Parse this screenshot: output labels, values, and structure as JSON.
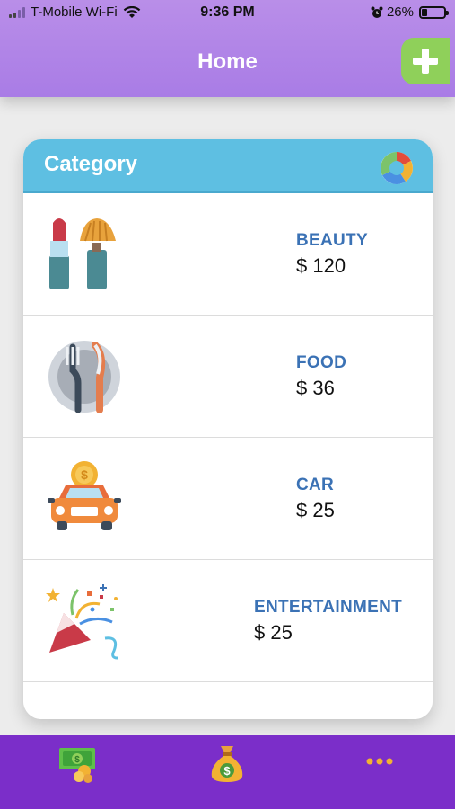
{
  "status": {
    "carrier": "T-Mobile Wi-Fi",
    "time": "9:36 PM",
    "battery": "26%"
  },
  "nav": {
    "title": "Home",
    "add_icon": "plus-icon"
  },
  "card": {
    "title": "Category",
    "chart_icon": "pie-chart-icon"
  },
  "categories": [
    {
      "name": "BEAUTY",
      "amount": "$ 120",
      "icon": "beauty-icon"
    },
    {
      "name": "FOOD",
      "amount": "$ 36",
      "icon": "food-icon"
    },
    {
      "name": "CAR",
      "amount": "$ 25",
      "icon": "car-icon"
    },
    {
      "name": "ENTERTAINMENT",
      "amount": "$ 25",
      "icon": "party-icon"
    }
  ],
  "tabs": [
    {
      "icon": "cash-icon"
    },
    {
      "icon": "money-bag-icon"
    },
    {
      "icon": "more-icon"
    }
  ],
  "colors": {
    "header": "#a97ce6",
    "card_header": "#5ebfe2",
    "category_label": "#3b72b5",
    "tabbar": "#7b2ec9",
    "add_button": "#8fd05a"
  }
}
